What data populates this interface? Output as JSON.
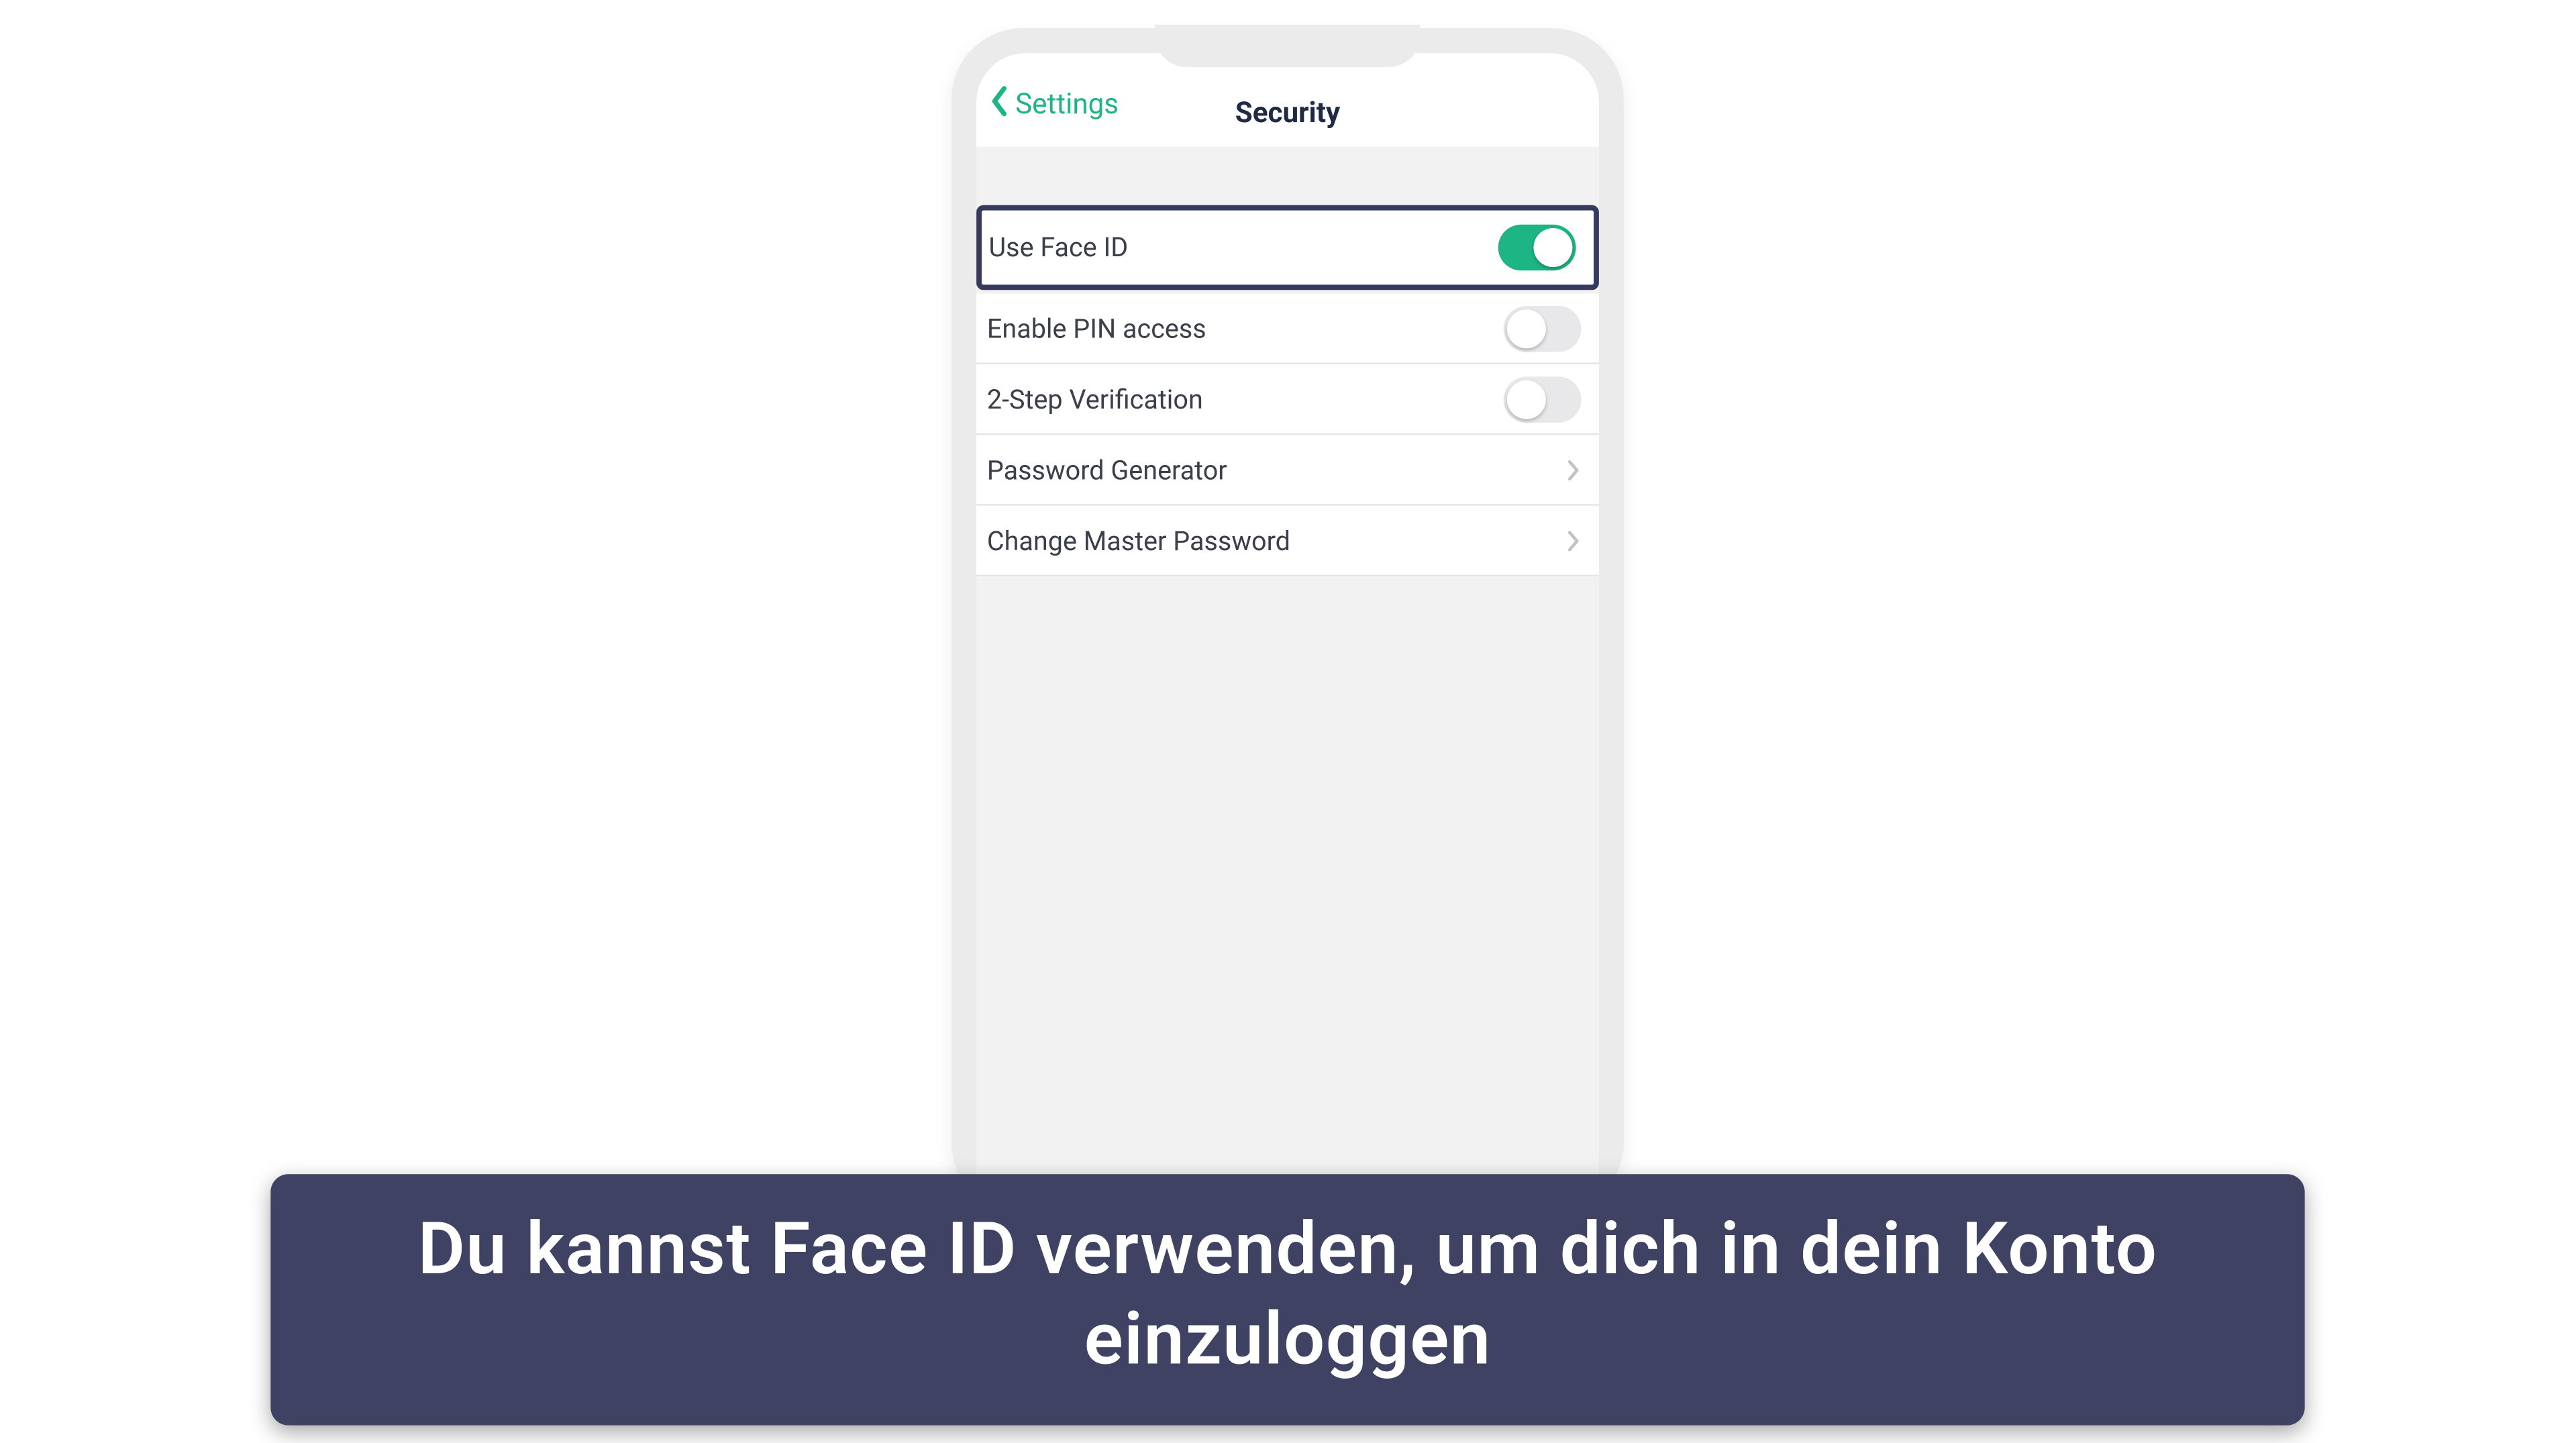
{
  "nav": {
    "back_label": "Settings",
    "title": "Security"
  },
  "rows": {
    "face_id": {
      "label": "Use Face ID",
      "on": true
    },
    "pin": {
      "label": "Enable PIN access",
      "on": false
    },
    "twostep": {
      "label": "2-Step Verification",
      "on": false
    },
    "pwgen": {
      "label": "Password Generator"
    },
    "master": {
      "label": "Change Master Password"
    }
  },
  "caption": "Du kannst Face ID verwenden, um dich in dein Konto einzuloggen",
  "colors": {
    "accent": "#1db584",
    "highlight_border": "#353a5e",
    "banner_bg": "#3f4263"
  }
}
